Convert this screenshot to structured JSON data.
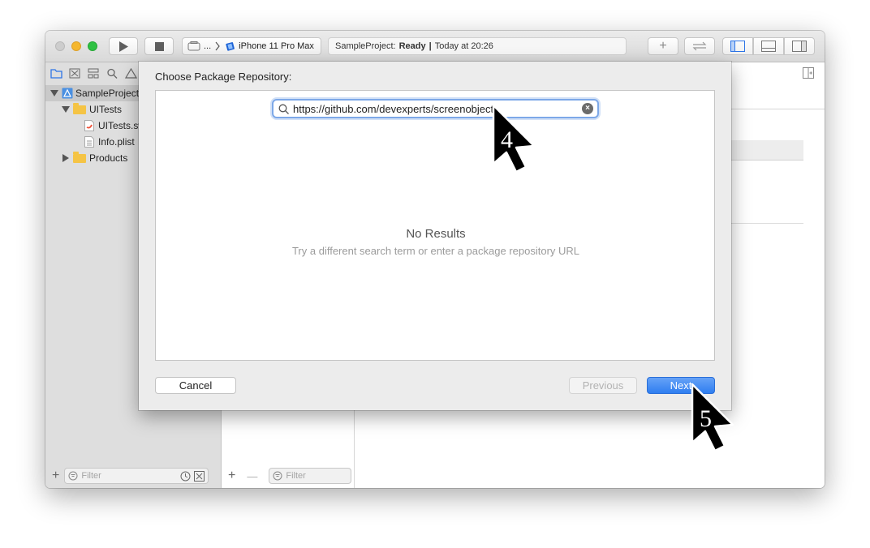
{
  "toolbar": {
    "scheme_ellipsis": "...",
    "device": "iPhone 11 Pro Max",
    "status_project": "SampleProject:",
    "status_state": "Ready",
    "status_sep": "|",
    "status_time": "Today at 20:26",
    "add_label": "+"
  },
  "navigator": {
    "items": [
      {
        "label": "SampleProject"
      },
      {
        "label": "UITests"
      },
      {
        "label": "UITests.swift"
      },
      {
        "label": "Info.plist"
      },
      {
        "label": "Products"
      }
    ],
    "filter_placeholder": "Filter",
    "add_label": "+"
  },
  "second_column": {
    "add_label": "+",
    "remove_label": "—",
    "filter_placeholder": "Filter"
  },
  "dialog": {
    "title": "Choose Package Repository:",
    "search_value": "https://github.com/devexperts/screenobject",
    "empty_title": "No Results",
    "empty_subtitle": "Try a different search term or enter a package repository URL",
    "cancel_label": "Cancel",
    "previous_label": "Previous",
    "next_label": "Next"
  },
  "annotations": {
    "step_4": "4",
    "step_5": "5"
  },
  "colors": {
    "accent": "#3a84f3",
    "traffic_close": "#cdcdcd",
    "traffic_min": "#f5b72f",
    "traffic_max": "#2ec142"
  }
}
